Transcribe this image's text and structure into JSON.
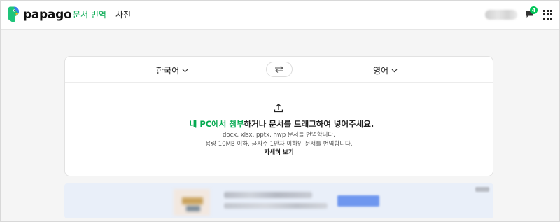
{
  "app": {
    "name": "papago",
    "brand_color": "#03a94f"
  },
  "nav": [
    {
      "label": "문서 번역",
      "active": true
    },
    {
      "label": "사전",
      "active": false
    }
  ],
  "header_right": {
    "notification_count": "4"
  },
  "translator": {
    "source_language": "한국어",
    "target_language": "영어",
    "upload": {
      "link_text": "내 PC에서 첨부",
      "instruction_rest": "하거나 문서를 드래그하여 넣어주세요.",
      "formats": "docx, xlsx, pptx, hwp 문서를 번역합니다.",
      "limits": "용량 10MB 이하, 글자수 1만자 이하인 문서를 번역합니다.",
      "details_link": "자세히 보기"
    }
  },
  "icons": [
    "papago-logo-icon",
    "notification-icon",
    "apps-grid-icon",
    "chevron-down-icon",
    "swap-icon",
    "upload-icon"
  ]
}
